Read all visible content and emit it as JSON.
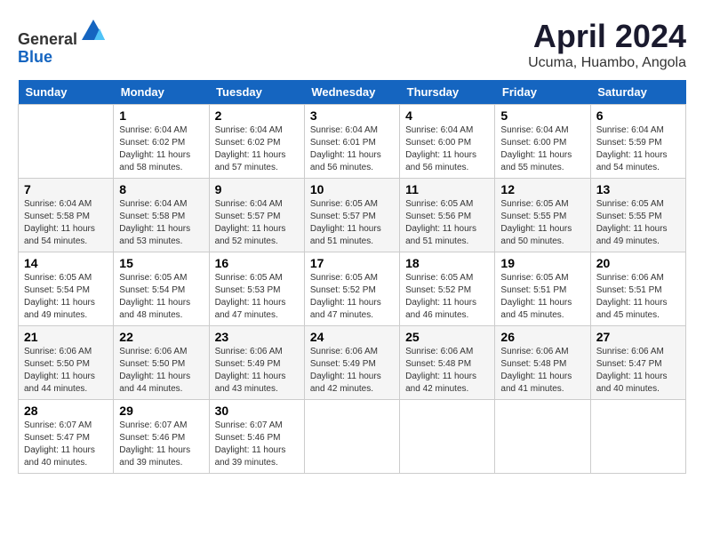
{
  "header": {
    "logo_line1": "General",
    "logo_line2": "Blue",
    "title": "April 2024",
    "subtitle": "Ucuma, Huambo, Angola"
  },
  "calendar": {
    "days_of_week": [
      "Sunday",
      "Monday",
      "Tuesday",
      "Wednesday",
      "Thursday",
      "Friday",
      "Saturday"
    ],
    "weeks": [
      [
        {
          "day": "",
          "sunrise": "",
          "sunset": "",
          "daylight": ""
        },
        {
          "day": "1",
          "sunrise": "Sunrise: 6:04 AM",
          "sunset": "Sunset: 6:02 PM",
          "daylight": "Daylight: 11 hours and 58 minutes."
        },
        {
          "day": "2",
          "sunrise": "Sunrise: 6:04 AM",
          "sunset": "Sunset: 6:02 PM",
          "daylight": "Daylight: 11 hours and 57 minutes."
        },
        {
          "day": "3",
          "sunrise": "Sunrise: 6:04 AM",
          "sunset": "Sunset: 6:01 PM",
          "daylight": "Daylight: 11 hours and 56 minutes."
        },
        {
          "day": "4",
          "sunrise": "Sunrise: 6:04 AM",
          "sunset": "Sunset: 6:00 PM",
          "daylight": "Daylight: 11 hours and 56 minutes."
        },
        {
          "day": "5",
          "sunrise": "Sunrise: 6:04 AM",
          "sunset": "Sunset: 6:00 PM",
          "daylight": "Daylight: 11 hours and 55 minutes."
        },
        {
          "day": "6",
          "sunrise": "Sunrise: 6:04 AM",
          "sunset": "Sunset: 5:59 PM",
          "daylight": "Daylight: 11 hours and 54 minutes."
        }
      ],
      [
        {
          "day": "7",
          "sunrise": "Sunrise: 6:04 AM",
          "sunset": "Sunset: 5:58 PM",
          "daylight": "Daylight: 11 hours and 54 minutes."
        },
        {
          "day": "8",
          "sunrise": "Sunrise: 6:04 AM",
          "sunset": "Sunset: 5:58 PM",
          "daylight": "Daylight: 11 hours and 53 minutes."
        },
        {
          "day": "9",
          "sunrise": "Sunrise: 6:04 AM",
          "sunset": "Sunset: 5:57 PM",
          "daylight": "Daylight: 11 hours and 52 minutes."
        },
        {
          "day": "10",
          "sunrise": "Sunrise: 6:05 AM",
          "sunset": "Sunset: 5:57 PM",
          "daylight": "Daylight: 11 hours and 51 minutes."
        },
        {
          "day": "11",
          "sunrise": "Sunrise: 6:05 AM",
          "sunset": "Sunset: 5:56 PM",
          "daylight": "Daylight: 11 hours and 51 minutes."
        },
        {
          "day": "12",
          "sunrise": "Sunrise: 6:05 AM",
          "sunset": "Sunset: 5:55 PM",
          "daylight": "Daylight: 11 hours and 50 minutes."
        },
        {
          "day": "13",
          "sunrise": "Sunrise: 6:05 AM",
          "sunset": "Sunset: 5:55 PM",
          "daylight": "Daylight: 11 hours and 49 minutes."
        }
      ],
      [
        {
          "day": "14",
          "sunrise": "Sunrise: 6:05 AM",
          "sunset": "Sunset: 5:54 PM",
          "daylight": "Daylight: 11 hours and 49 minutes."
        },
        {
          "day": "15",
          "sunrise": "Sunrise: 6:05 AM",
          "sunset": "Sunset: 5:54 PM",
          "daylight": "Daylight: 11 hours and 48 minutes."
        },
        {
          "day": "16",
          "sunrise": "Sunrise: 6:05 AM",
          "sunset": "Sunset: 5:53 PM",
          "daylight": "Daylight: 11 hours and 47 minutes."
        },
        {
          "day": "17",
          "sunrise": "Sunrise: 6:05 AM",
          "sunset": "Sunset: 5:52 PM",
          "daylight": "Daylight: 11 hours and 47 minutes."
        },
        {
          "day": "18",
          "sunrise": "Sunrise: 6:05 AM",
          "sunset": "Sunset: 5:52 PM",
          "daylight": "Daylight: 11 hours and 46 minutes."
        },
        {
          "day": "19",
          "sunrise": "Sunrise: 6:05 AM",
          "sunset": "Sunset: 5:51 PM",
          "daylight": "Daylight: 11 hours and 45 minutes."
        },
        {
          "day": "20",
          "sunrise": "Sunrise: 6:06 AM",
          "sunset": "Sunset: 5:51 PM",
          "daylight": "Daylight: 11 hours and 45 minutes."
        }
      ],
      [
        {
          "day": "21",
          "sunrise": "Sunrise: 6:06 AM",
          "sunset": "Sunset: 5:50 PM",
          "daylight": "Daylight: 11 hours and 44 minutes."
        },
        {
          "day": "22",
          "sunrise": "Sunrise: 6:06 AM",
          "sunset": "Sunset: 5:50 PM",
          "daylight": "Daylight: 11 hours and 44 minutes."
        },
        {
          "day": "23",
          "sunrise": "Sunrise: 6:06 AM",
          "sunset": "Sunset: 5:49 PM",
          "daylight": "Daylight: 11 hours and 43 minutes."
        },
        {
          "day": "24",
          "sunrise": "Sunrise: 6:06 AM",
          "sunset": "Sunset: 5:49 PM",
          "daylight": "Daylight: 11 hours and 42 minutes."
        },
        {
          "day": "25",
          "sunrise": "Sunrise: 6:06 AM",
          "sunset": "Sunset: 5:48 PM",
          "daylight": "Daylight: 11 hours and 42 minutes."
        },
        {
          "day": "26",
          "sunrise": "Sunrise: 6:06 AM",
          "sunset": "Sunset: 5:48 PM",
          "daylight": "Daylight: 11 hours and 41 minutes."
        },
        {
          "day": "27",
          "sunrise": "Sunrise: 6:06 AM",
          "sunset": "Sunset: 5:47 PM",
          "daylight": "Daylight: 11 hours and 40 minutes."
        }
      ],
      [
        {
          "day": "28",
          "sunrise": "Sunrise: 6:07 AM",
          "sunset": "Sunset: 5:47 PM",
          "daylight": "Daylight: 11 hours and 40 minutes."
        },
        {
          "day": "29",
          "sunrise": "Sunrise: 6:07 AM",
          "sunset": "Sunset: 5:46 PM",
          "daylight": "Daylight: 11 hours and 39 minutes."
        },
        {
          "day": "30",
          "sunrise": "Sunrise: 6:07 AM",
          "sunset": "Sunset: 5:46 PM",
          "daylight": "Daylight: 11 hours and 39 minutes."
        },
        {
          "day": "",
          "sunrise": "",
          "sunset": "",
          "daylight": ""
        },
        {
          "day": "",
          "sunrise": "",
          "sunset": "",
          "daylight": ""
        },
        {
          "day": "",
          "sunrise": "",
          "sunset": "",
          "daylight": ""
        },
        {
          "day": "",
          "sunrise": "",
          "sunset": "",
          "daylight": ""
        }
      ]
    ]
  }
}
